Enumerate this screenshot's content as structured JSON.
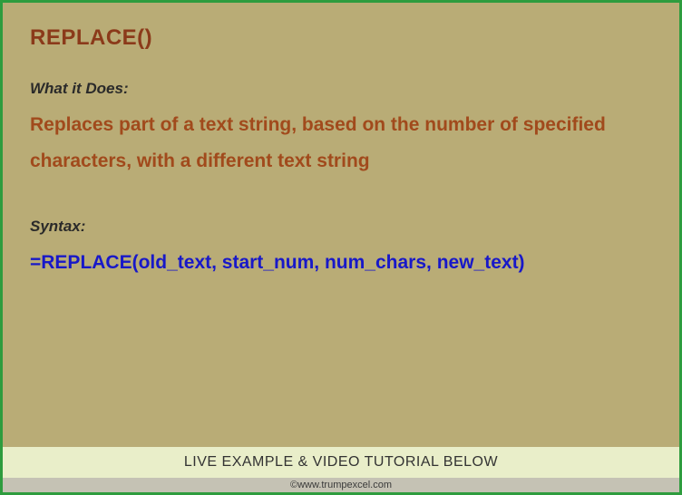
{
  "title": "REPLACE()",
  "whatItDoes": {
    "label": "What it Does:",
    "description": "Replaces part of a text string, based on the number of specified characters, with a different text string"
  },
  "syntax": {
    "label": "Syntax:",
    "formula": "=REPLACE(old_text, start_num, num_chars, new_text)"
  },
  "footer": {
    "banner": "LIVE EXAMPLE & VIDEO TUTORIAL BELOW",
    "attribution": "©www.trumpexcel.com"
  }
}
